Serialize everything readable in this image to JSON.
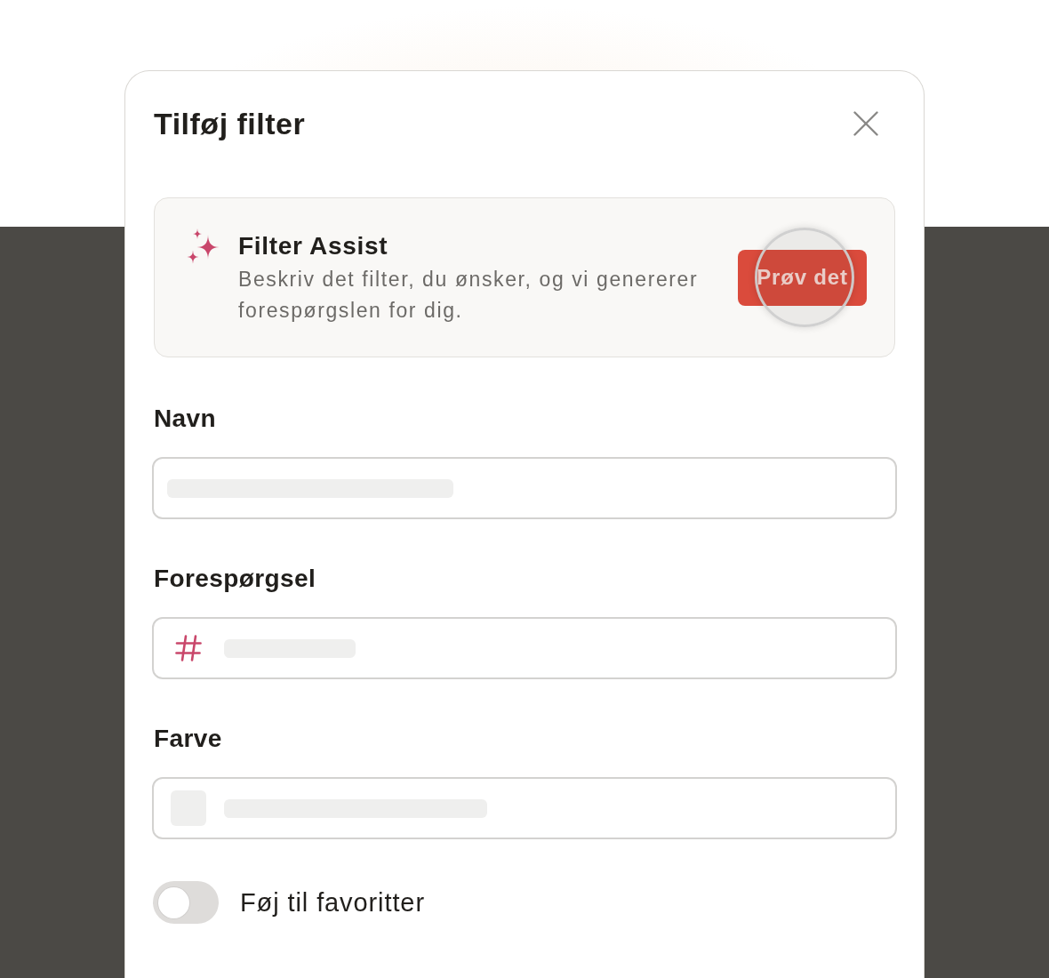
{
  "dialog": {
    "title": "Tilføj filter"
  },
  "assist": {
    "title": "Filter Assist",
    "description": "Beskriv det filter, du ønsker, og vi genererer forespørgslen for dig.",
    "button": {
      "label": "Prøv det",
      "tapped": true
    }
  },
  "fields": [
    {
      "label": "Navn",
      "kind": "text"
    },
    {
      "label": "Forespørgsel",
      "kind": "query"
    },
    {
      "label": "Farve",
      "kind": "color"
    }
  ],
  "favorite_toggle": {
    "label": "Føj til favoritter",
    "on": false
  }
}
